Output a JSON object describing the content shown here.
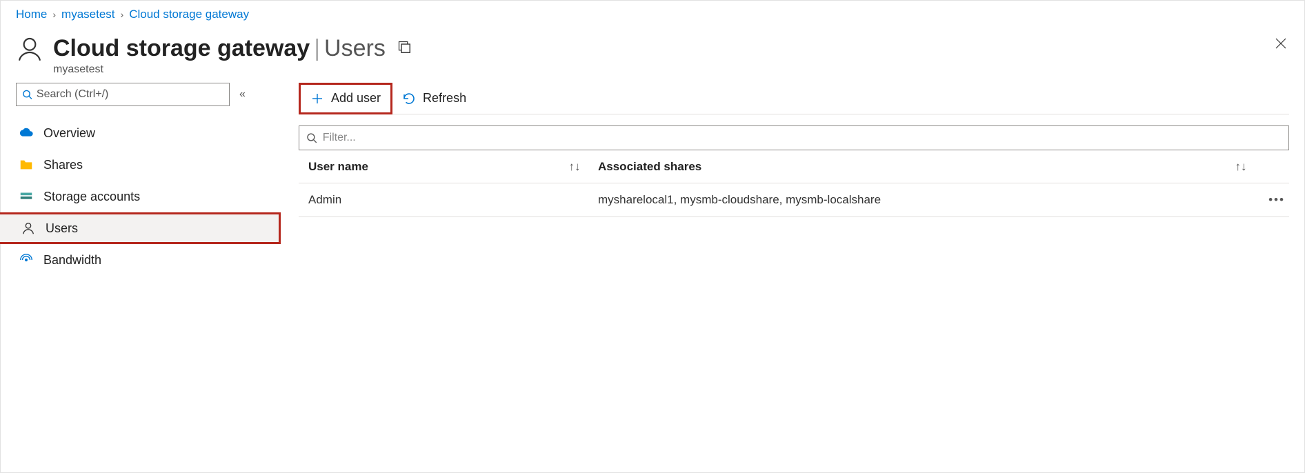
{
  "breadcrumb": {
    "items": [
      {
        "label": "Home"
      },
      {
        "label": "myasetest"
      },
      {
        "label": "Cloud storage gateway"
      }
    ]
  },
  "header": {
    "title_main": "Cloud storage gateway",
    "title_section": "Users",
    "subtitle": "myasetest"
  },
  "sidebar": {
    "search_placeholder": "Search (Ctrl+/)",
    "items": [
      {
        "label": "Overview"
      },
      {
        "label": "Shares"
      },
      {
        "label": "Storage accounts"
      },
      {
        "label": "Users"
      },
      {
        "label": "Bandwidth"
      }
    ]
  },
  "toolbar": {
    "add_user_label": "Add user",
    "refresh_label": "Refresh"
  },
  "filter": {
    "placeholder": "Filter..."
  },
  "table": {
    "columns": {
      "username": "User name",
      "shares": "Associated shares"
    },
    "rows": [
      {
        "username": "Admin",
        "shares": "mysharelocal1, mysmb-cloudshare, mysmb-localshare"
      }
    ]
  }
}
